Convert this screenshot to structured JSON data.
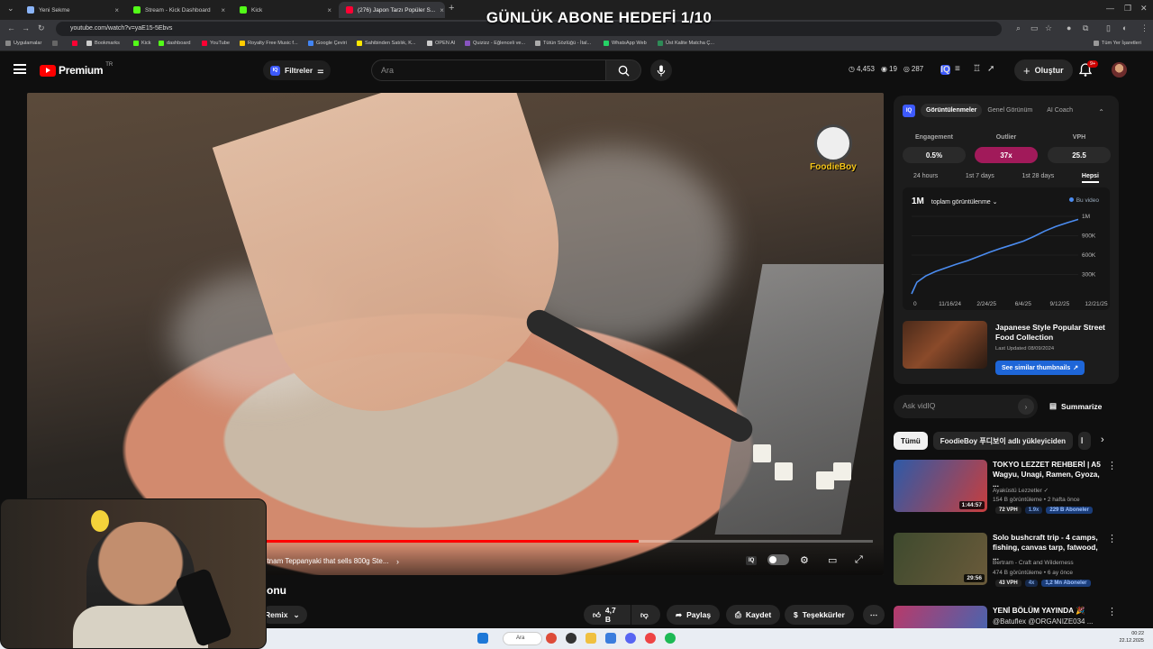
{
  "overlay_title": "GÜNLÜK ABONE HEDEFİ 1/10",
  "browser": {
    "tabs": [
      {
        "label": "Yeni Sekme",
        "color": "#8ab4f8"
      },
      {
        "label": "Stream - Kick Dashboard",
        "color": "#53fc18"
      },
      {
        "label": "Kick",
        "color": "#53fc18"
      },
      {
        "label": "(276) Japon Tarzı Popüler S...",
        "color": "#ff0033"
      }
    ],
    "url": "youtube.com/watch?v=yaE15-5Ebvs",
    "bookmarks": [
      {
        "label": "Uygulamalar",
        "color": "#888888"
      },
      {
        "label": "Bookmarks",
        "color": "#cccccc"
      },
      {
        "label": "Kick",
        "color": "#53fc18"
      },
      {
        "label": "dashboard",
        "color": "#53fc18"
      },
      {
        "label": "YouTube",
        "color": "#ff0033"
      },
      {
        "label": "Royalty Free Music f...",
        "color": "#ffcc00"
      },
      {
        "label": "Google Çeviri",
        "color": "#4285f4"
      },
      {
        "label": "Sahibinden Satılık, K...",
        "color": "#ffe800"
      },
      {
        "label": "OPEN AI",
        "color": "#cccccc"
      },
      {
        "label": "Quizizz - Eğlenceli ve...",
        "color": "#8854c0"
      },
      {
        "label": "Tütün Sözlüğü - İtal...",
        "color": "#aaaaaa"
      },
      {
        "label": "WhatsApp Web",
        "color": "#25d366"
      },
      {
        "label": "Üst Kalite Matcha Ç...",
        "color": "#2e8b57"
      }
    ],
    "all_bookmarks": "Tüm Yer İşaretleri"
  },
  "masthead": {
    "logo_word": "Premium",
    "logo_country": "TR",
    "filters_label": "Filtreler",
    "search_placeholder": "Ara",
    "stats": {
      "views": "4,453",
      "s2": "19",
      "s3": "287"
    },
    "create_label": "Oluştur",
    "notif_badge": "9+"
  },
  "player": {
    "watermark": "FoodieBoy",
    "chapter_title": "etnam Teppanyaki that sells 800g Ste...",
    "progress_fraction": 0.72
  },
  "below": {
    "title_fragment": "onu",
    "remix_label": "Remix",
    "like_count": "4,7 B",
    "share_label": "Paylaş",
    "save_label": "Kaydet",
    "thanks_label": "Teşekkürler"
  },
  "vidiq": {
    "badge": "IQ",
    "tabs": [
      "Görüntülenmeler",
      "Genel Görünüm",
      "AI Coach"
    ],
    "metric_labels": [
      "Engagement",
      "Outlier",
      "VPH"
    ],
    "metric_values": [
      "0.5%",
      "37x",
      "25.5"
    ],
    "ranges": [
      "24 hours",
      "1st 7 days",
      "1st 28 days",
      "Hepsi"
    ],
    "chart_big": "1M",
    "chart_select": "toplam görüntülenme",
    "chart_legend": "Bu video",
    "thumb_title": "Japanese Style Popular Street Food Collection",
    "thumb_meta": "Last Updated 08/09/2024",
    "see_similar": "See similar thumbnails",
    "ask_placeholder": "Ask vidIQ",
    "summarize": "Summarize"
  },
  "chart_data": {
    "type": "line",
    "title": "",
    "xlabel": "",
    "ylabel": "",
    "x_ticks": [
      "0",
      "11/16/24",
      "2/24/25",
      "6/4/25",
      "9/12/25",
      "12/21/25"
    ],
    "y_ticks": [
      "0",
      "300K",
      "600K",
      "900K",
      "1M"
    ],
    "ylim": [
      0,
      1000000
    ],
    "grid": true,
    "series": [
      {
        "name": "Bu video",
        "color": "#4b8cf0",
        "x": [
          "2024-08-09",
          "2024-08-25",
          "2024-09-20",
          "2024-10-20",
          "2024-11-16",
          "2024-12-20",
          "2025-01-25",
          "2025-02-24",
          "2025-04-01",
          "2025-05-05",
          "2025-06-04",
          "2025-07-10",
          "2025-08-10",
          "2025-09-12",
          "2025-10-15",
          "2025-11-20",
          "2025-12-21"
        ],
        "y": [
          0,
          150000,
          230000,
          290000,
          330000,
          380000,
          430000,
          480000,
          540000,
          590000,
          630000,
          680000,
          740000,
          810000,
          870000,
          920000,
          960000
        ]
      }
    ]
  },
  "chips": [
    "Tümü",
    "FoodieBoy 푸디보이 adlı yükleyiciden",
    "İ"
  ],
  "recommendations": [
    {
      "title": "TOKYO LEZZET REHBERİ | A5 Wagyu, Unagi, Ramen, Gyoza, ...",
      "channel": "Ayaküstü Lezzetler ✓",
      "meta": "154 B görüntüleme • 2 hafta önce",
      "duration": "1:44:57",
      "vph": "72 VPH",
      "outlier": "1.9x",
      "subs": "229 B Aboneler",
      "colors": [
        "#2d5aa8",
        "#c83e3e"
      ]
    },
    {
      "title": "Solo bushcraft trip - 4 camps, fishing, canvas tarp, fatwood, ...",
      "channel": "Bertram - Craft and Wilderness",
      "meta": "474 B görüntüleme • 6 ay önce",
      "duration": "29:56",
      "vph": "43 VPH",
      "outlier": "4x",
      "subs": "1,2 Mn Aboneler",
      "colors": [
        "#3e4a2e",
        "#6a5a3a"
      ]
    },
    {
      "title": "YENİ BÖLÜM YAYINDA 🎉",
      "channel": "@Batuflex @ORGANIZE034 ...",
      "meta": "",
      "duration": "",
      "vph": "",
      "outlier": "",
      "subs": "",
      "colors": [
        "#b83a6a",
        "#3a6ab8"
      ]
    }
  ],
  "taskbar": {
    "search": "Ara",
    "time": "00:22",
    "date": "22.12.2025"
  }
}
